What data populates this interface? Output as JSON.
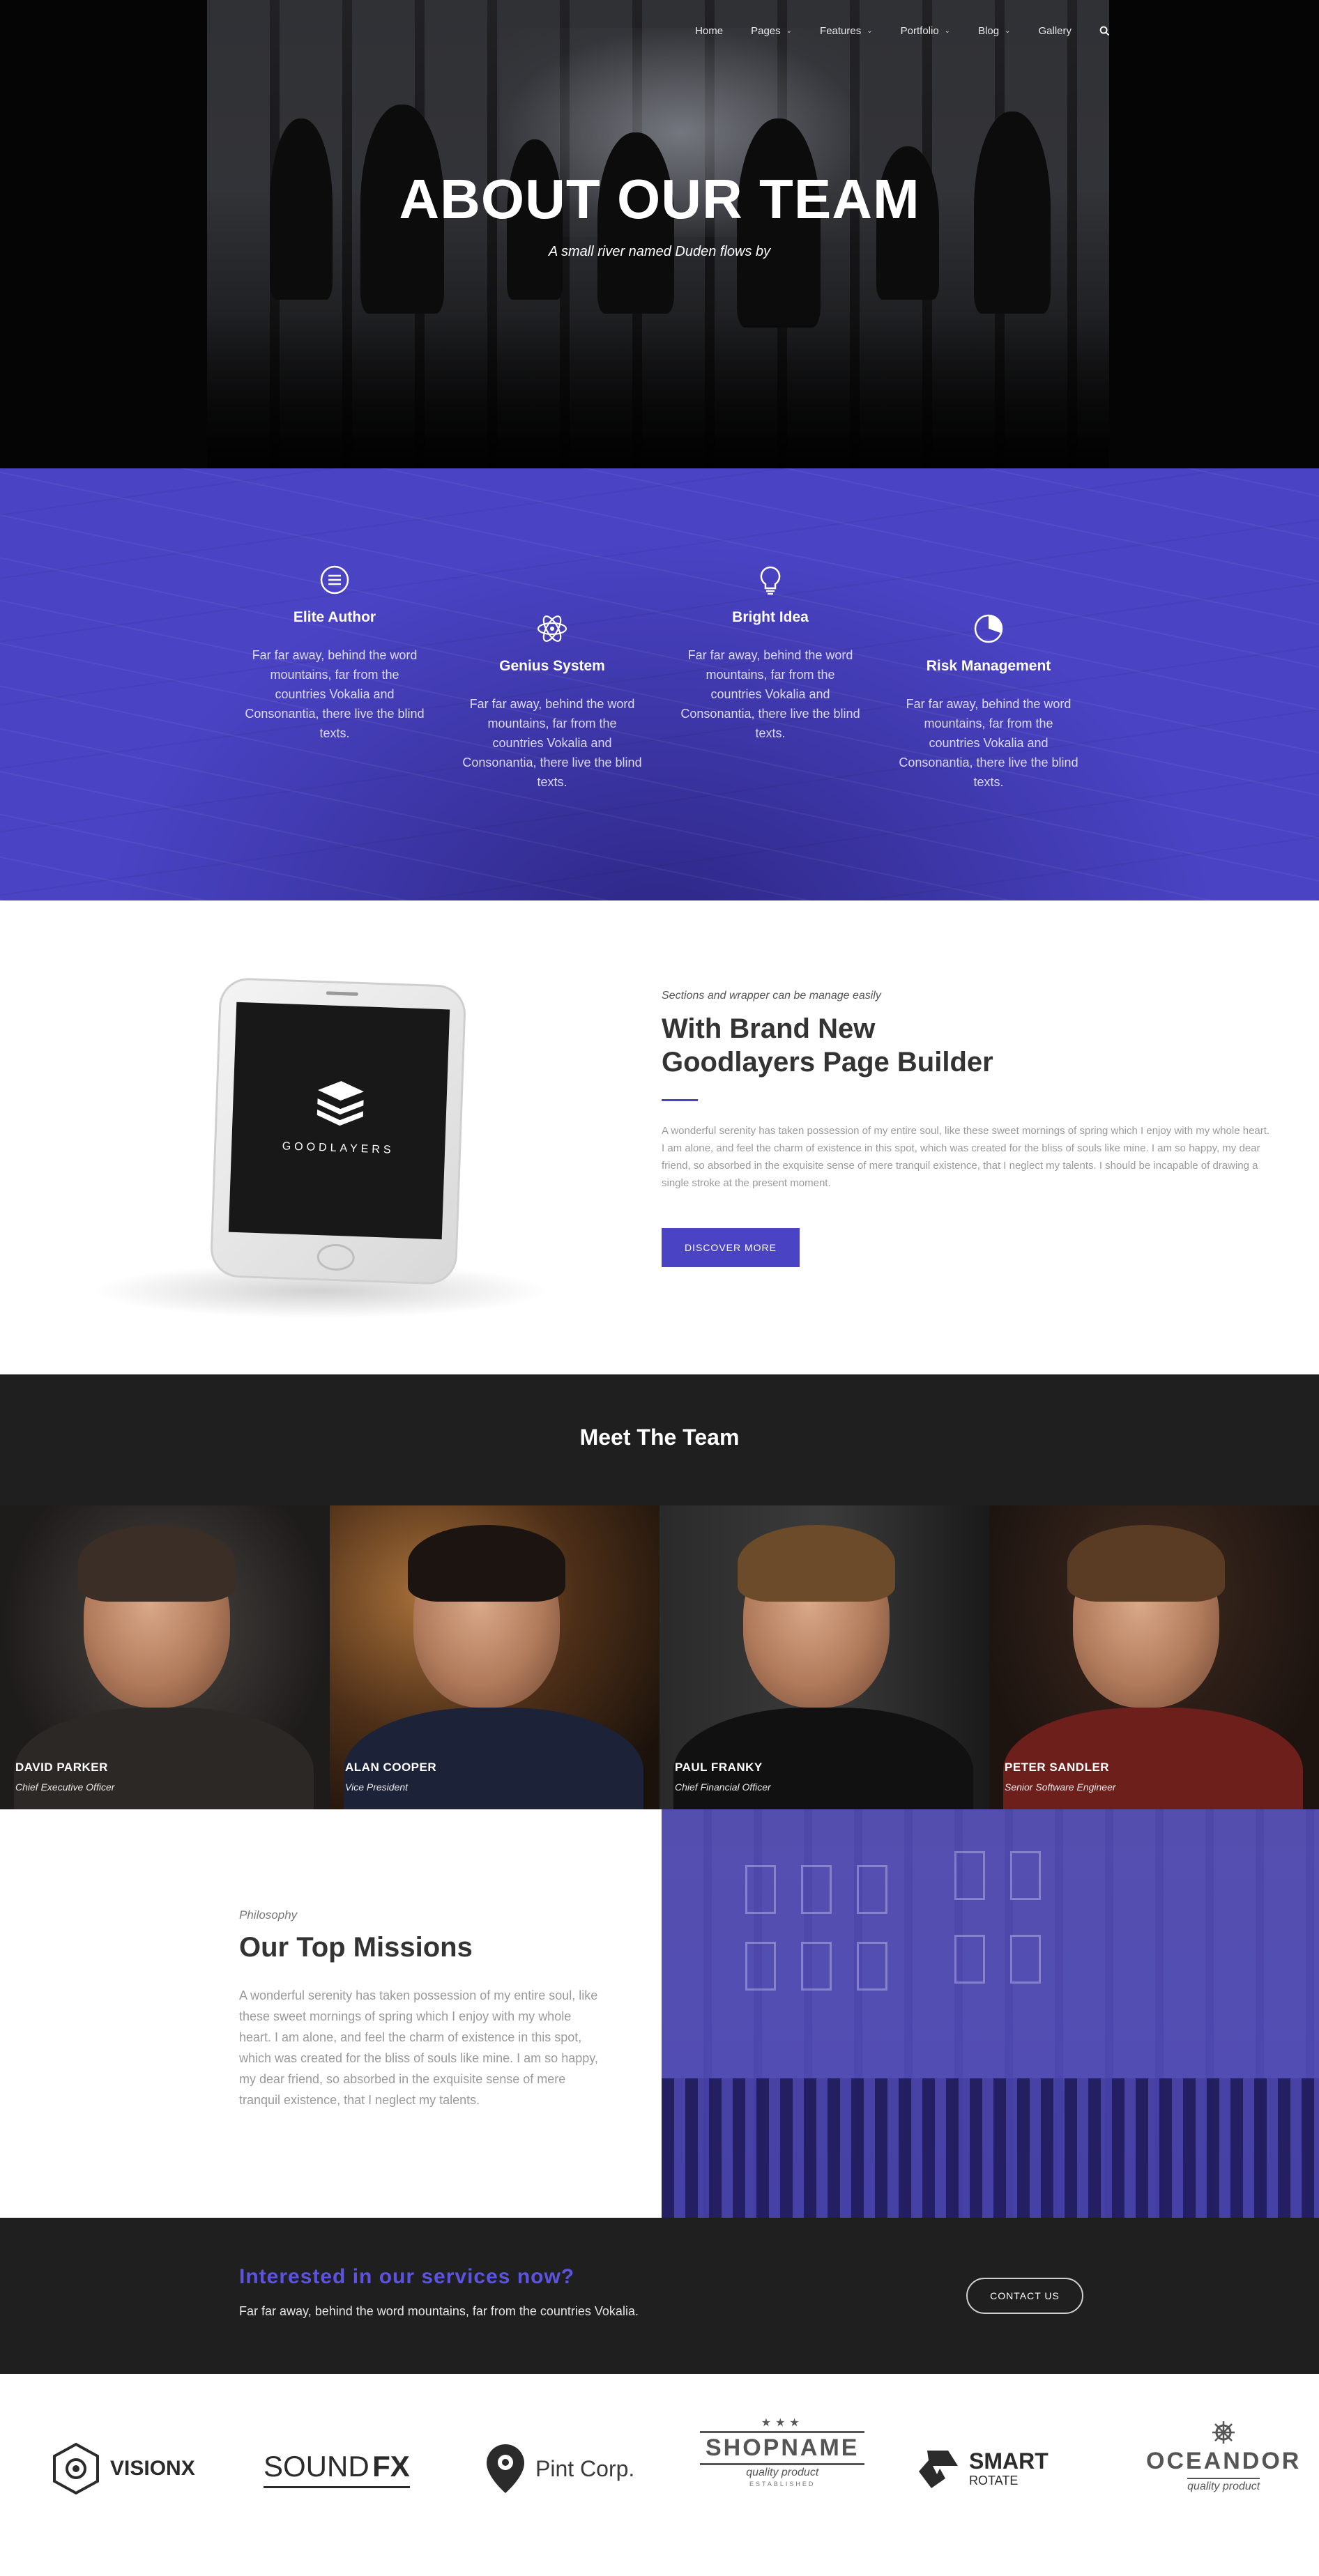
{
  "nav": {
    "items": [
      {
        "label": "Home",
        "dropdown": false
      },
      {
        "label": "Pages",
        "dropdown": true
      },
      {
        "label": "Features",
        "dropdown": true
      },
      {
        "label": "Portfolio",
        "dropdown": true
      },
      {
        "label": "Blog",
        "dropdown": true
      },
      {
        "label": "Gallery",
        "dropdown": false
      }
    ],
    "search_icon": "search-icon"
  },
  "hero": {
    "title": "ABOUT OUR TEAM",
    "subtitle": "A small river named Duden flows by"
  },
  "features": [
    {
      "icon": "menu-circle-icon",
      "title": "Elite Author",
      "text": "Far far away, behind the word mountains, far from the countries Vokalia and Consonantia, there live the blind texts."
    },
    {
      "icon": "atom-icon",
      "title": "Genius System",
      "text": "Far far away, behind the word mountains, far from the countries Vokalia and Consonantia, there live the blind texts."
    },
    {
      "icon": "lightbulb-icon",
      "title": "Bright Idea",
      "text": "Far far away, behind the word mountains, far from the countries Vokalia and Consonantia, there live the blind texts."
    },
    {
      "icon": "pie-chart-icon",
      "title": "Risk Management",
      "text": "Far far away, behind the word mountains, far from the countries Vokalia and Consonantia, there live the blind texts."
    }
  ],
  "builder": {
    "phone_brand": "GOODLAYERS",
    "kicker": "Sections and wrapper can be manage easily",
    "title_line1": "With Brand New",
    "title_line2": "Goodlayers Page Builder",
    "description": "A wonderful serenity has taken possession of my entire soul, like these sweet mornings of spring which I enjoy with my whole heart. I am alone, and feel the charm of existence in this spot, which was created for the bliss of souls like mine. I am so happy, my dear friend, so absorbed in the exquisite sense of mere tranquil existence, that I neglect my talents. I should be incapable of drawing a single stroke at the present moment.",
    "button_label": "DISCOVER MORE"
  },
  "team": {
    "heading": "Meet The Team",
    "members": [
      {
        "name": "DAVID PARKER",
        "role": "Chief Executive Officer"
      },
      {
        "name": "ALAN COOPER",
        "role": "Vice President"
      },
      {
        "name": "PAUL FRANKY",
        "role": "Chief Financial Officer"
      },
      {
        "name": "PETER SANDLER",
        "role": "Senior Software Engineer"
      }
    ]
  },
  "missions": {
    "kicker": "Philosophy",
    "title": "Our Top Missions",
    "description": "A wonderful serenity has taken possession of my entire soul, like these sweet mornings of spring which I enjoy with my whole heart. I am alone, and feel the charm of existence in this spot, which was created for the bliss of souls like mine. I am so happy, my dear friend, so absorbed in the exquisite sense of mere tranquil existence, that I neglect my talents."
  },
  "cta": {
    "title": "Interested in our services now?",
    "text": "Far far away, behind the word mountains, far from the countries Vokalia.",
    "button_label": "CONTACT US"
  },
  "logos": {
    "visionx": "VISIONX",
    "soundfx_a": "SOUND",
    "soundfx_b": "FX",
    "pint": "Pint Corp.",
    "shopname": "SHOPNAME",
    "shopname_tag": "quality product",
    "shopname_est": "ESTABLISHED",
    "smart": "SMART",
    "smart_sub": "ROTATE",
    "oceandor": "OCEANDOR",
    "oceandor_tag": "quality product"
  },
  "colors": {
    "accent": "#4a43c4",
    "cta_title": "#5c54e0",
    "dark_band": "#1f1f1f"
  }
}
